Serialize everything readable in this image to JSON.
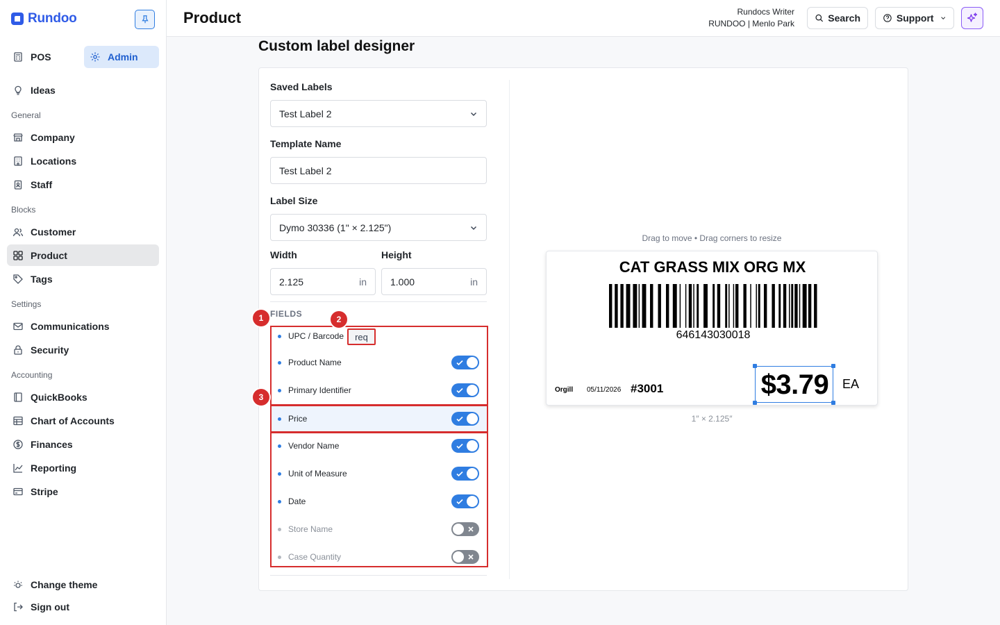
{
  "brand": {
    "name": "Rundoo"
  },
  "modes": {
    "pos": "POS",
    "admin": "Admin"
  },
  "sidebar": {
    "ideas": "Ideas",
    "sections": {
      "general": "General",
      "blocks": "Blocks",
      "settings": "Settings",
      "accounting": "Accounting"
    },
    "general": [
      "Company",
      "Locations",
      "Staff"
    ],
    "blocks": [
      "Customer",
      "Product",
      "Tags"
    ],
    "settings": [
      "Communications",
      "Security"
    ],
    "accounting": [
      "QuickBooks",
      "Chart of Accounts",
      "Finances",
      "Reporting",
      "Stripe"
    ],
    "bottom": {
      "theme": "Change theme",
      "signout": "Sign out"
    }
  },
  "header": {
    "title": "Product",
    "user_name": "Rundocs Writer",
    "org": "RUNDOO | Menlo Park",
    "search_label": "Search",
    "support_label": "Support"
  },
  "designer": {
    "title": "Custom label designer",
    "saved_labels_label": "Saved Labels",
    "saved_labels_value": "Test Label 2",
    "template_name_label": "Template Name",
    "template_name_value": "Test Label 2",
    "label_size_label": "Label Size",
    "label_size_value": "Dymo 30336 (1\" × 2.125\")",
    "width_label": "Width",
    "width_value": "2.125",
    "height_label": "Height",
    "height_value": "1.000",
    "unit": "in",
    "fields_heading": "FIELDS",
    "required_tag": "req",
    "fields": [
      {
        "name": "UPC / Barcode",
        "enabled": true
      },
      {
        "name": "Product Name",
        "enabled": true
      },
      {
        "name": "Primary Identifier",
        "enabled": true
      },
      {
        "name": "Price",
        "enabled": true
      },
      {
        "name": "Vendor Name",
        "enabled": true
      },
      {
        "name": "Unit of Measure",
        "enabled": true
      },
      {
        "name": "Date",
        "enabled": true
      },
      {
        "name": "Store Name",
        "enabled": false
      },
      {
        "name": "Case Quantity",
        "enabled": false
      }
    ],
    "annotations": [
      "1",
      "2",
      "3"
    ]
  },
  "preview": {
    "hint": "Drag to move • Drag corners to resize",
    "product_name": "CAT GRASS MIX ORG MX",
    "upc": "646143030018",
    "vendor": "Orgill",
    "date": "05/11/2026",
    "identifier": "#3001",
    "price": "$3.79",
    "uom": "EA",
    "size_caption": "1″ × 2.125″"
  },
  "colors": {
    "accent": "#2f7de1",
    "brand": "#2f5be7",
    "annotation": "#d62d2d"
  }
}
